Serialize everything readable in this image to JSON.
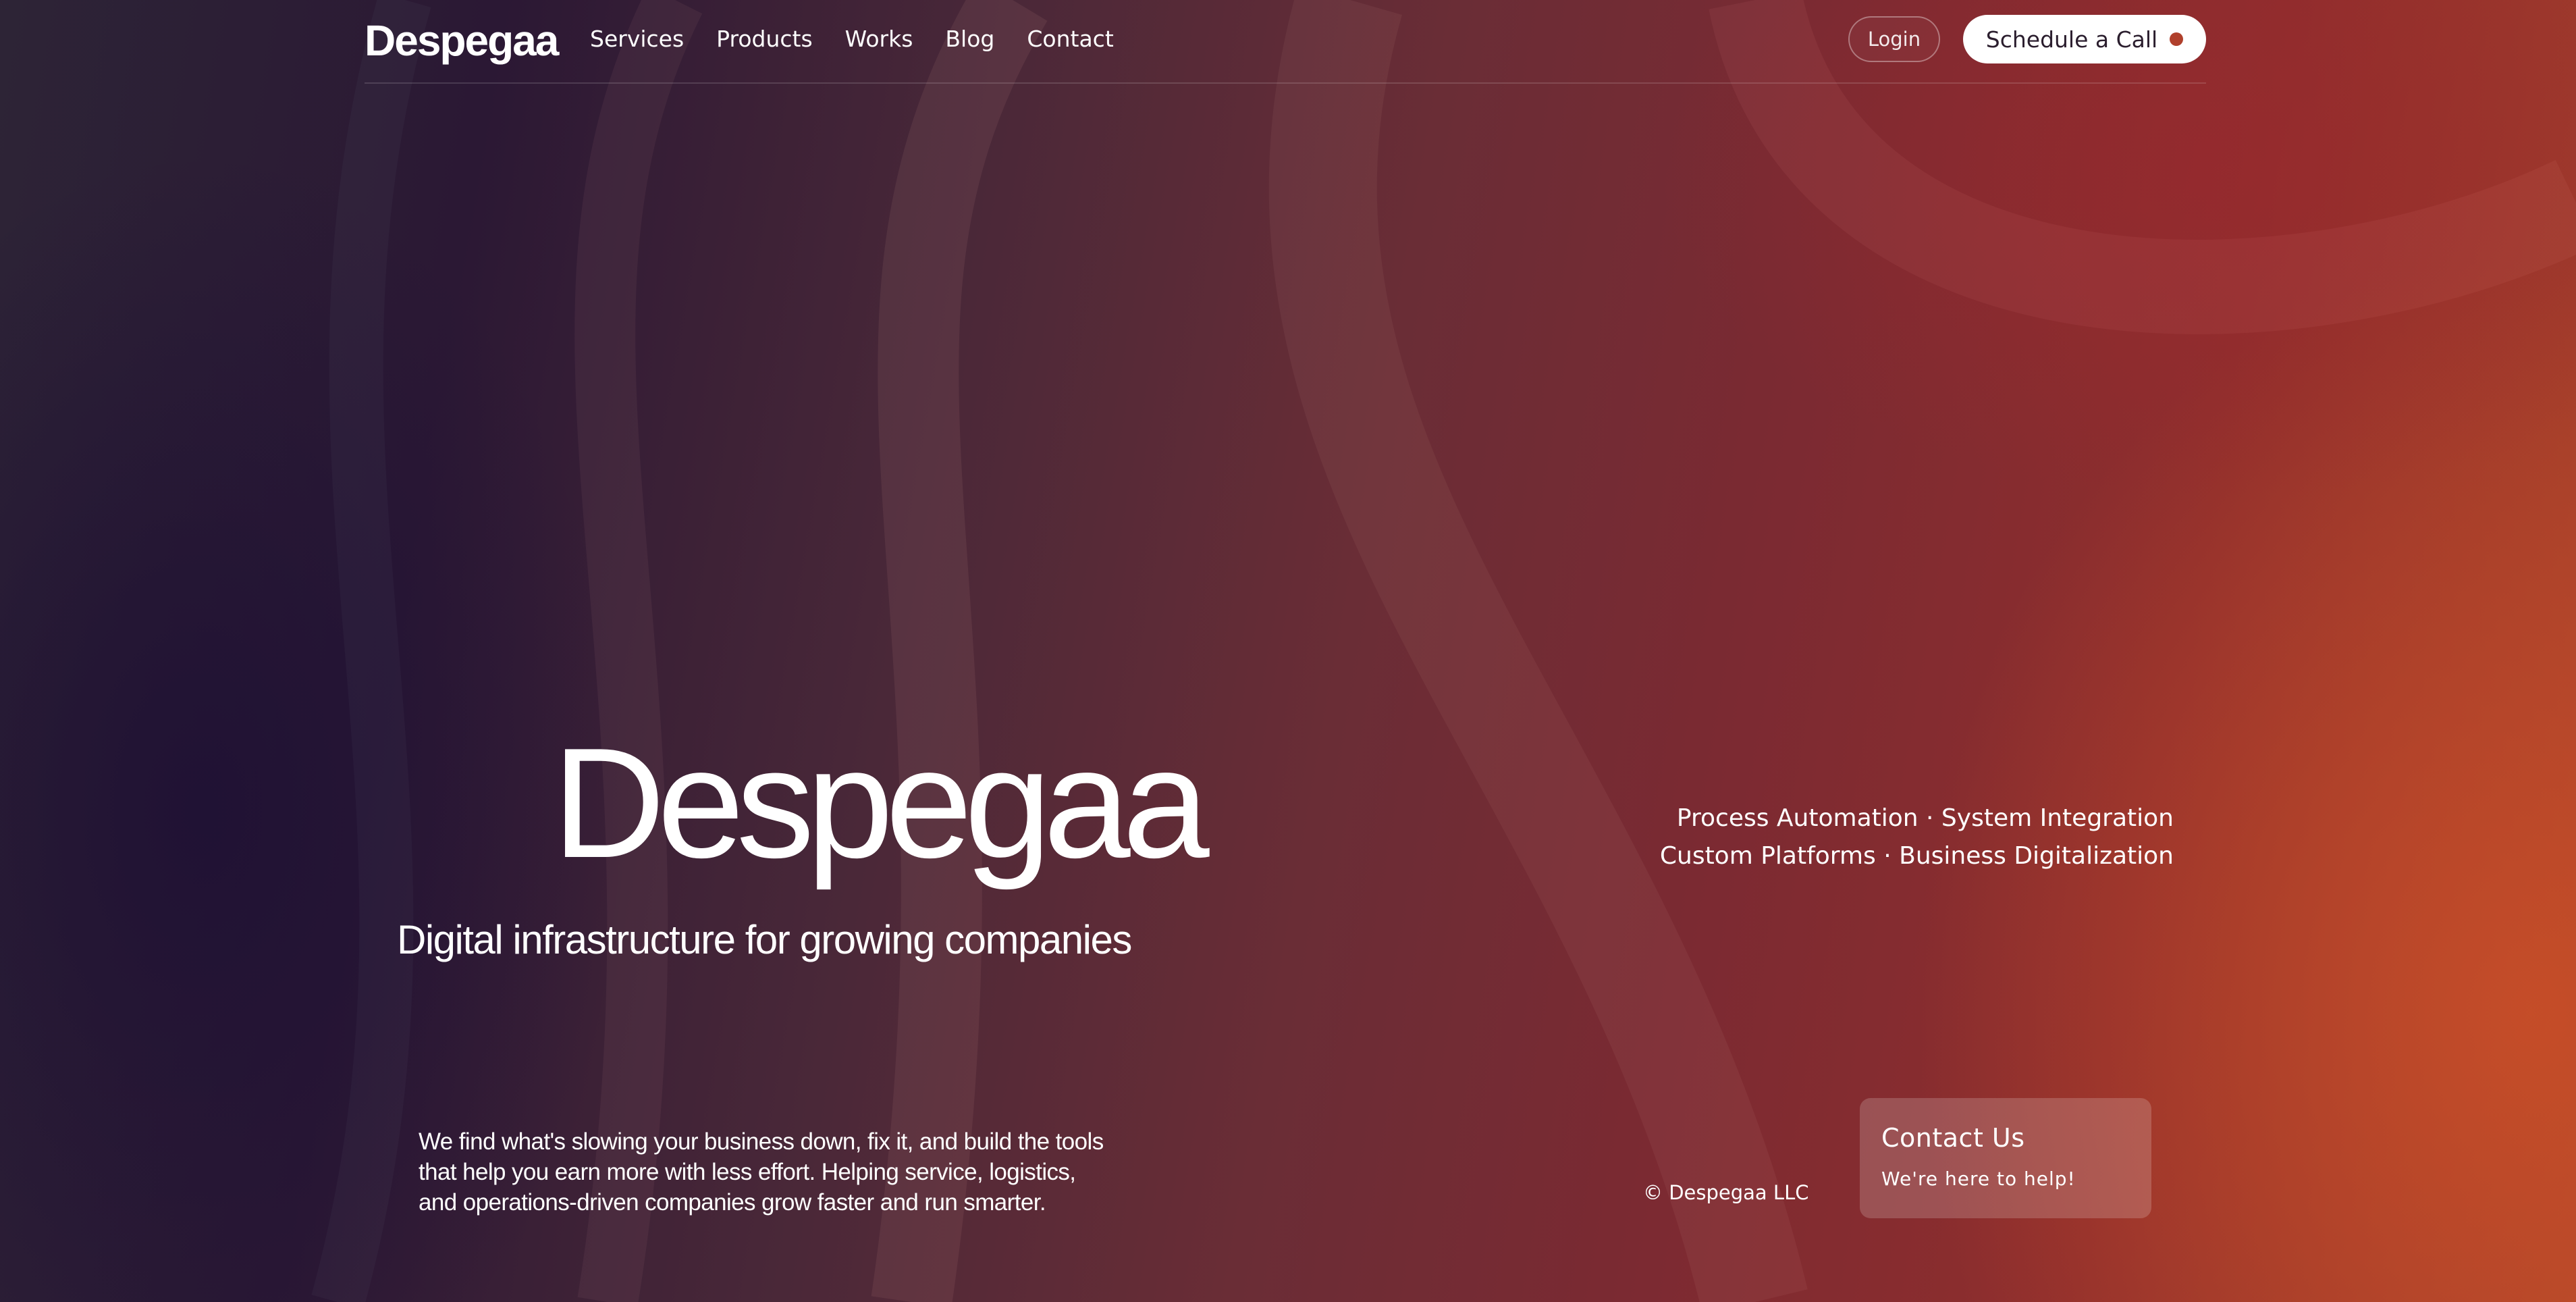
{
  "nav": {
    "logo": "Despegaa",
    "links": [
      {
        "label": "Services"
      },
      {
        "label": "Products"
      },
      {
        "label": "Works"
      },
      {
        "label": "Blog"
      },
      {
        "label": "Contact"
      }
    ],
    "login_label": "Login",
    "cta_label": "Schedule a Call"
  },
  "hero": {
    "title": "Despegaa",
    "subtitle": "Digital infrastructure for growing companies",
    "services_lines": [
      "Process Automation · System Integration",
      "Custom Platforms · Business Digitalization"
    ],
    "description_lines": [
      "We find what's slowing your business down, fix it, and build the tools",
      "that help you earn more with less effort. Helping service, logistics,",
      "and operations-driven companies grow faster and run smarter."
    ]
  },
  "footer": {
    "copyright": "© Despegaa LLC"
  },
  "contact_widget": {
    "title": "Contact Us",
    "subtitle": "We're here to help!"
  },
  "colors": {
    "accent_dot": "#b0402c",
    "cta_background": "#ffffff",
    "cta_text": "#2b1e2e"
  }
}
